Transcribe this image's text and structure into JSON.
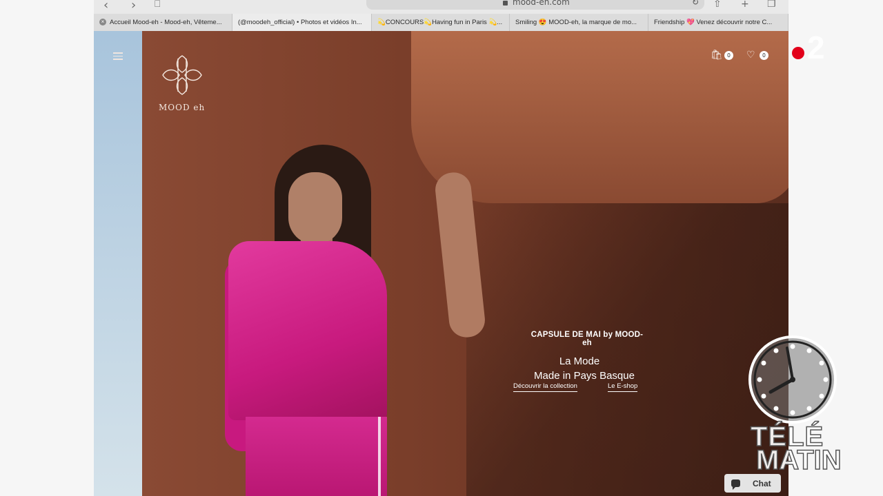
{
  "browser": {
    "url": "mood-eh.com",
    "tabs": [
      {
        "label": "Accueil Mood-eh - Mood-eh, Vêteme..."
      },
      {
        "label": "(@moodeh_official) • Photos et vidéos In..."
      },
      {
        "label": "💫CONCOURS💫Having fun in Paris 💫..."
      },
      {
        "label": "Smiling 😍 MOOD-eh, la marque de mo..."
      },
      {
        "label": "Friendship 💖 Venez découvrir notre C..."
      }
    ]
  },
  "site": {
    "logo_text": "MOOD eh",
    "cart_count": "0",
    "wishlist_count": "0",
    "hero": {
      "kicker": "CAPSULE DE MAI by MOOD-eh",
      "line1": "La Mode",
      "line2": "Made in Pays Basque",
      "cta_collection": "Découvrir la collection",
      "cta_eshop": "Le E-shop"
    },
    "chat_label": "Chat"
  },
  "overlay": {
    "channel_number": "2",
    "show_line1": "TÉLÉ",
    "show_line2": "MATIN"
  },
  "icons": [
    "back-icon",
    "forward-icon",
    "bookmarks-icon",
    "lock-icon",
    "reload-icon",
    "share-icon",
    "new-tab-icon",
    "tabs-icon",
    "tab-close-icon",
    "menu-icon",
    "cart-icon",
    "heart-icon",
    "chat-icon",
    "clock-icon"
  ],
  "colors": {
    "accent_pink": "#c8197f",
    "channel_red": "#e2001a",
    "sculpture_rust": "#8a4a34"
  }
}
